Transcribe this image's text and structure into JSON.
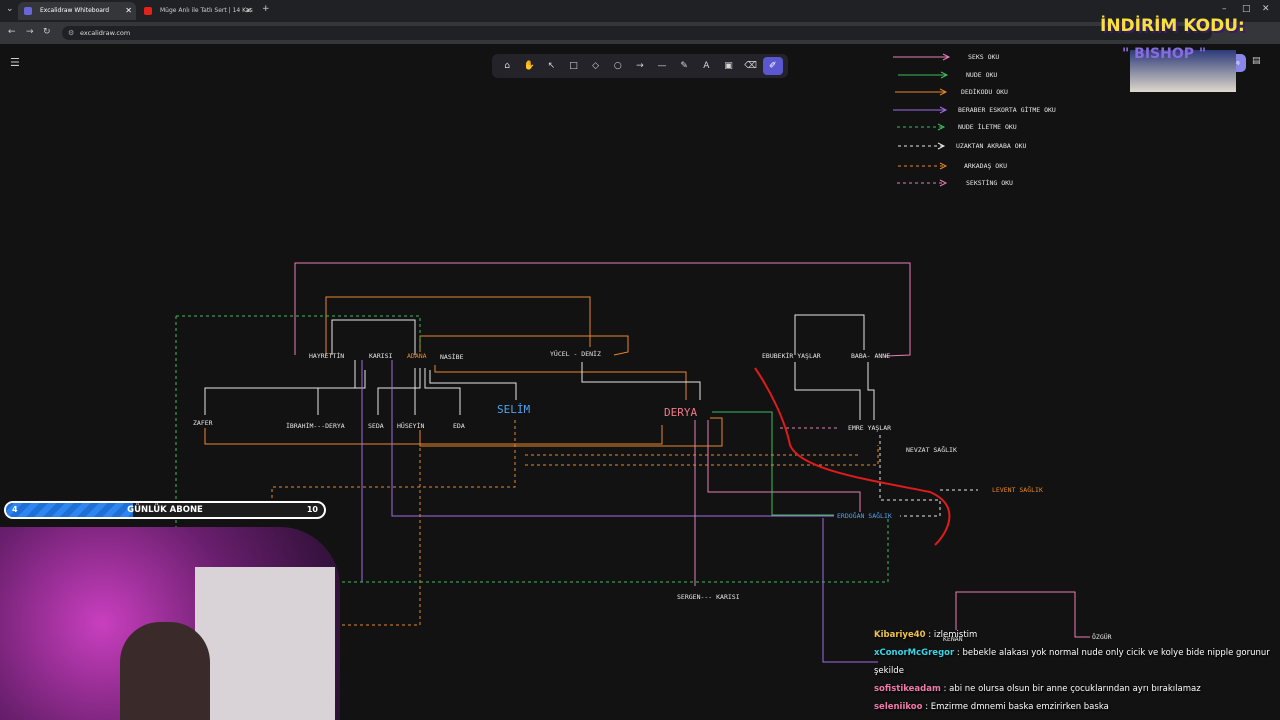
{
  "browser": {
    "tabs": [
      {
        "title": "Excalidraw Whiteboard",
        "active": true
      },
      {
        "title": "Müge Anlı ile Tatlı Sert | 14 Kas",
        "active": false
      }
    ],
    "url": "excalidraw.com"
  },
  "toolbar": {
    "tools": [
      "lock-icon",
      "hand-icon",
      "selection-icon",
      "rectangle-icon",
      "diamond-icon",
      "ellipse-icon",
      "arrow-icon",
      "line-icon",
      "draw-icon",
      "text-icon",
      "image-icon",
      "eraser-icon",
      "laser-icon"
    ],
    "active_tool": "laser-icon"
  },
  "share_label": "Paylaş",
  "legend": [
    {
      "label": "SEKS OKU",
      "color": "#e87fb6",
      "dashed": false
    },
    {
      "label": "NUDE OKU",
      "color": "#3fbf5f",
      "dashed": false
    },
    {
      "label": "DEDİKODU OKU",
      "color": "#e8872c",
      "dashed": false
    },
    {
      "label": "BERABER ESKORTA GİTME OKU",
      "color": "#a06ee8",
      "dashed": false
    },
    {
      "label": "NUDE İLETME OKU",
      "color": "#3fbf5f",
      "dashed": true
    },
    {
      "label": "UZAKTAN AKRABA OKU",
      "color": "#e6e6e6",
      "dashed": true
    },
    {
      "label": "ARKADAŞ OKU",
      "color": "#e8872c",
      "dashed": true
    },
    {
      "label": "SEKSTİNG OKU",
      "color": "#e87fb6",
      "dashed": true
    }
  ],
  "diagram_labels": {
    "hayrettin": "HAYRETTİN",
    "karisi": "KARISI",
    "adana": "ADANA",
    "nasibe": "NASİBE",
    "yucel_deniz": "YÜCEL - DENİZ",
    "ebubekir": "EBUBEKİR YAŞLAR",
    "baba_anne": "BABA- ANNE",
    "zafer": "ZAFER",
    "ibrahim_derya": "İBRAHİM---DERYA",
    "seda": "SEDA",
    "huseyin": "HÜSEYİN",
    "eda": "EDA",
    "selim": "SELİM",
    "derya": "DERYA",
    "emre": "EMRE YAŞLAR",
    "nevzat": "NEVZAT SAĞLIK",
    "levent": "LEVENT SAĞLIK",
    "erdogan": "ERDOĞAN SAĞLIK",
    "sergen": "SERGEN--- KARISI",
    "ozgur": "ÖZGÜR",
    "kenan": "KENAN"
  },
  "promo": {
    "line1": "İNDİRİM KODU:",
    "line2": "\" BISHOP \""
  },
  "subscriber_goal": {
    "label": "GÜNLÜK ABONE",
    "current": "4",
    "goal": "10",
    "progress": 0.4
  },
  "chat": [
    {
      "user": "Kibariye40",
      "color": "#f0c24a",
      "text": "izlemistim"
    },
    {
      "user": "xConorMcGregor",
      "color": "#3ad6e8",
      "text": "bebekle alakası yok normal nude only cicik ve kolye bide nipple gorunur şekilde"
    },
    {
      "user": "sofistikeadam",
      "color": "#f07aa8",
      "text": "abi ne olursa olsun bir anne çocuklarından ayrı bırakılamaz"
    },
    {
      "user": "seleniikoo",
      "color": "#f07aa8",
      "text": "Emzirme dmnemi baska emzirirken baska"
    }
  ]
}
